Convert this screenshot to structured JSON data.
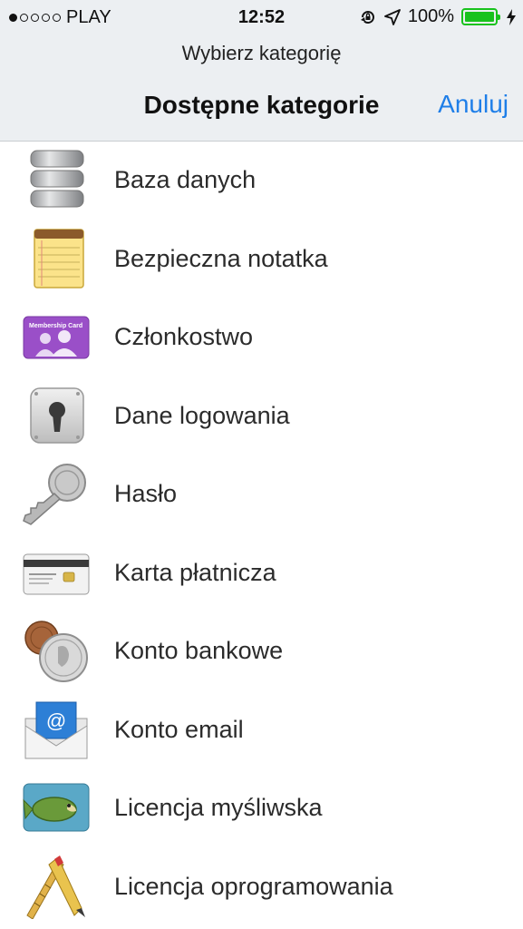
{
  "status_bar": {
    "carrier": "PLAY",
    "time": "12:52",
    "battery": "100%",
    "signal_bars_filled": 1,
    "signal_bars_total": 5,
    "icons": [
      "rotation-lock-icon",
      "location-arrow-icon",
      "battery-icon",
      "charging-bolt-icon"
    ],
    "battery_color": "#18c21d"
  },
  "nav": {
    "prompt": "Wybierz kategorię",
    "title": "Dostępne kategorie",
    "cancel_label": "Anuluj",
    "accent_color": "#1e7ee8"
  },
  "categories": [
    {
      "label": "Baza danych",
      "icon": "database-icon"
    },
    {
      "label": "Bezpieczna notatka",
      "icon": "notepad-icon"
    },
    {
      "label": "Członkostwo",
      "icon": "membership-card-icon",
      "icon_text": "Membership Card"
    },
    {
      "label": "Dane logowania",
      "icon": "keyhole-icon"
    },
    {
      "label": "Hasło",
      "icon": "key-icon"
    },
    {
      "label": "Karta płatnicza",
      "icon": "credit-card-icon"
    },
    {
      "label": "Konto bankowe",
      "icon": "coins-icon"
    },
    {
      "label": "Konto email",
      "icon": "email-envelope-icon",
      "icon_text": "@"
    },
    {
      "label": "Licencja myśliwska",
      "icon": "fish-icon"
    },
    {
      "label": "Licencja oprogramowania",
      "icon": "pencil-ruler-icon"
    }
  ]
}
